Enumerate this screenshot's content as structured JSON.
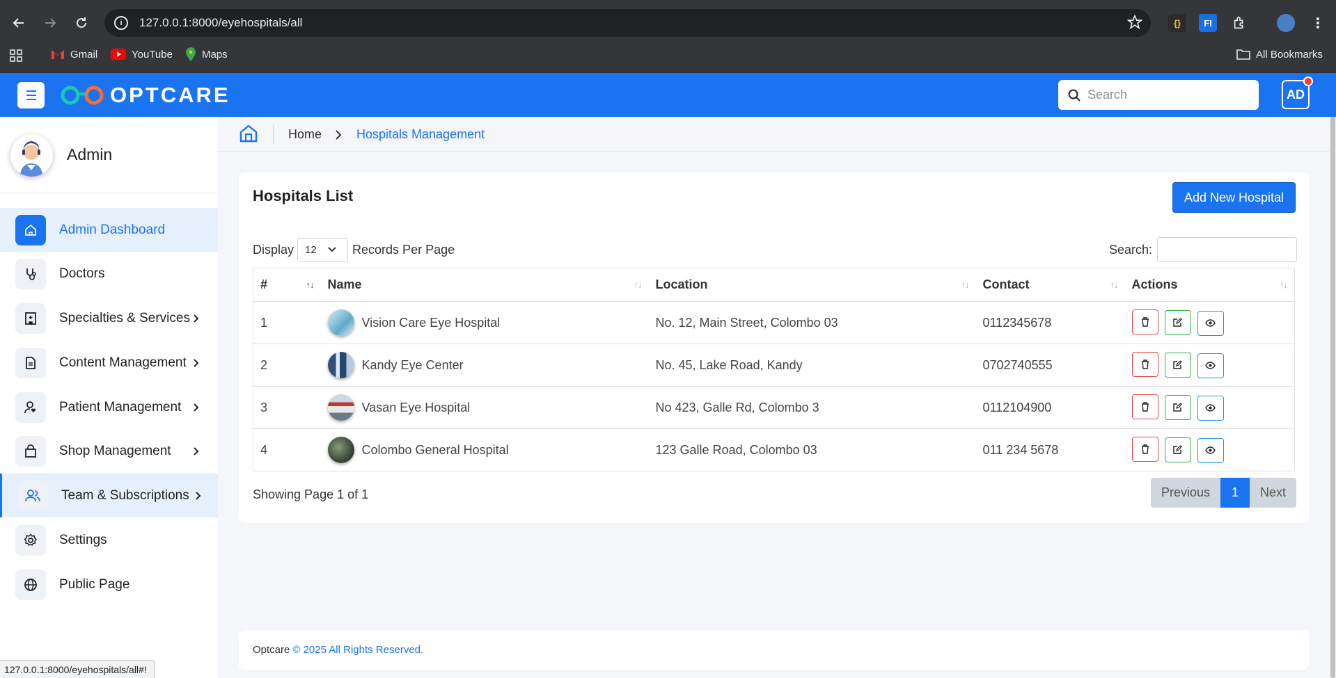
{
  "browser": {
    "url": "127.0.0.1:8000/eyehospitals/all",
    "bookmarks": [
      "Gmail",
      "YouTube",
      "Maps"
    ],
    "all_bookmarks_label": "All Bookmarks",
    "extension_fi_label": "FI",
    "status_url": "127.0.0.1:8000/eyehospitals/all#!"
  },
  "header": {
    "logo_text": "OPTCARE",
    "search_placeholder": "Search",
    "avatar_initials": "AD"
  },
  "sidebar": {
    "user_name": "Admin",
    "items": [
      {
        "label": "Admin Dashboard",
        "icon": "home-icon",
        "has_chevron": false
      },
      {
        "label": "Doctors",
        "icon": "stethoscope-icon",
        "has_chevron": false
      },
      {
        "label": "Specialties & Services",
        "icon": "building-icon",
        "has_chevron": true
      },
      {
        "label": "Content Management",
        "icon": "document-icon",
        "has_chevron": true
      },
      {
        "label": "Patient Management",
        "icon": "patient-icon",
        "has_chevron": true
      },
      {
        "label": "Shop Management",
        "icon": "shopping-bag-icon",
        "has_chevron": true
      },
      {
        "label": "Team & Subscriptions",
        "icon": "team-icon",
        "has_chevron": true
      },
      {
        "label": "Settings",
        "icon": "gear-icon",
        "has_chevron": false
      },
      {
        "label": "Public Page",
        "icon": "globe-icon",
        "has_chevron": false
      }
    ]
  },
  "breadcrumb": {
    "home": "Home",
    "current": "Hospitals Management"
  },
  "card": {
    "title": "Hospitals List",
    "add_button": "Add New Hospital",
    "display_label": "Display",
    "per_page_value": "12",
    "per_page_suffix": "Records Per Page",
    "search_label": "Search:",
    "columns": [
      "#",
      "Name",
      "Location",
      "Contact",
      "Actions"
    ],
    "rows": [
      {
        "num": "1",
        "name": "Vision Care Eye Hospital",
        "location": "No. 12, Main Street, Colombo 03",
        "contact": "0112345678"
      },
      {
        "num": "2",
        "name": "Kandy Eye Center",
        "location": "No. 45, Lake Road, Kandy",
        "contact": "0702740555"
      },
      {
        "num": "3",
        "name": "Vasan Eye Hospital",
        "location": "No 423, Galle Rd, Colombo 3",
        "contact": "0112104900"
      },
      {
        "num": "4",
        "name": "Colombo General Hospital",
        "location": "123 Galle Road, Colombo 03",
        "contact": "011 234 5678"
      }
    ],
    "page_info": "Showing Page 1 of 1",
    "pagination": {
      "previous": "Previous",
      "current": "1",
      "next": "Next"
    }
  },
  "footer": {
    "brand": "Optcare",
    "rights": "© 2025 All Rights Reserved."
  },
  "colors": {
    "primary": "#1a73f0",
    "danger": "#e04848",
    "success": "#2db34a",
    "info": "#1a9ad6"
  }
}
